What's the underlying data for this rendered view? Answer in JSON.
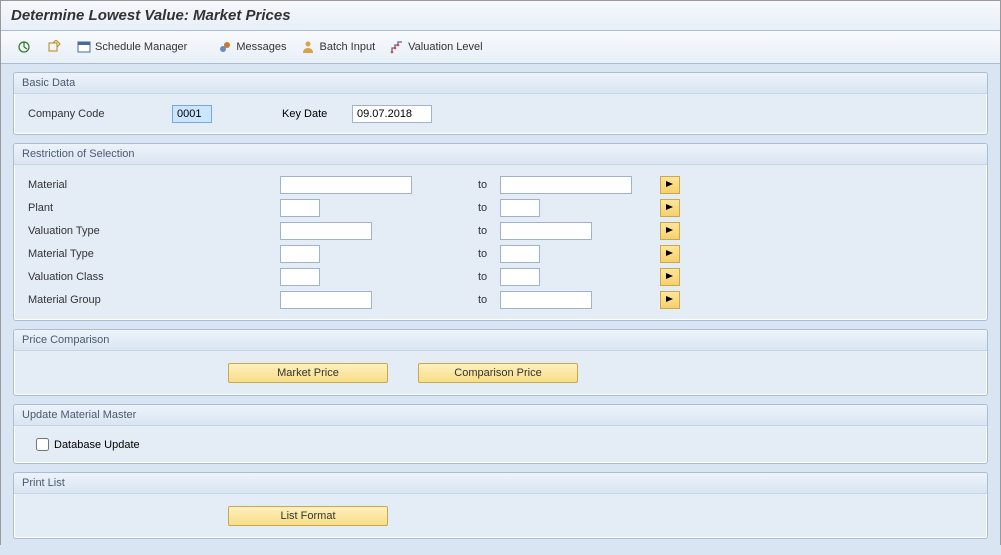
{
  "title": "Determine Lowest Value: Market Prices",
  "toolbar": {
    "schedule_manager": "Schedule Manager",
    "messages": "Messages",
    "batch_input": "Batch Input",
    "valuation_level": "Valuation Level"
  },
  "basic_data": {
    "title": "Basic Data",
    "company_code_label": "Company Code",
    "company_code_value": "0001",
    "key_date_label": "Key Date",
    "key_date_value": "09.07.2018"
  },
  "restriction": {
    "title": "Restriction of Selection",
    "to_label": "to",
    "rows": [
      {
        "label": "Material",
        "from": "",
        "to": "",
        "size": "lg"
      },
      {
        "label": "Plant",
        "from": "",
        "to": "",
        "size": "sm"
      },
      {
        "label": "Valuation Type",
        "from": "",
        "to": "",
        "size": "md"
      },
      {
        "label": "Material Type",
        "from": "",
        "to": "",
        "size": "sm"
      },
      {
        "label": "Valuation Class",
        "from": "",
        "to": "",
        "size": "sm"
      },
      {
        "label": "Material Group",
        "from": "",
        "to": "",
        "size": "md"
      }
    ]
  },
  "price_comparison": {
    "title": "Price Comparison",
    "market_price": "Market Price",
    "comparison_price": "Comparison Price"
  },
  "update_master": {
    "title": "Update Material Master",
    "database_update": "Database Update"
  },
  "print_list": {
    "title": "Print List",
    "list_format": "List Format"
  }
}
